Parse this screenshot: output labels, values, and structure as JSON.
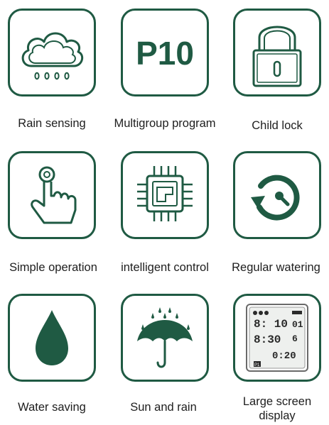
{
  "accent_color": "#1f5a43",
  "features": [
    {
      "label": "Rain sensing",
      "icon": "rain-cloud-icon"
    },
    {
      "label": "Multigroup program",
      "icon": "p10-program-icon",
      "icon_text": "P10"
    },
    {
      "label": "Child lock",
      "icon": "padlock-icon"
    },
    {
      "label": "Simple operation",
      "icon": "finger-press-icon"
    },
    {
      "label": "intelligent control",
      "icon": "chip-icon"
    },
    {
      "label": "Regular watering",
      "icon": "timer-cycle-icon"
    },
    {
      "label": "Water saving",
      "icon": "water-drop-icon"
    },
    {
      "label": "Sun and rain",
      "icon": "umbrella-rain-icon"
    },
    {
      "label_lines": [
        "Large screen",
        "display"
      ],
      "icon": "lcd-screen-icon",
      "screen": {
        "row1": "8: 10",
        "row1b": "01",
        "row2": "8:30",
        "row2b": "6",
        "row3": "0:20",
        "tag": "P1"
      }
    }
  ]
}
